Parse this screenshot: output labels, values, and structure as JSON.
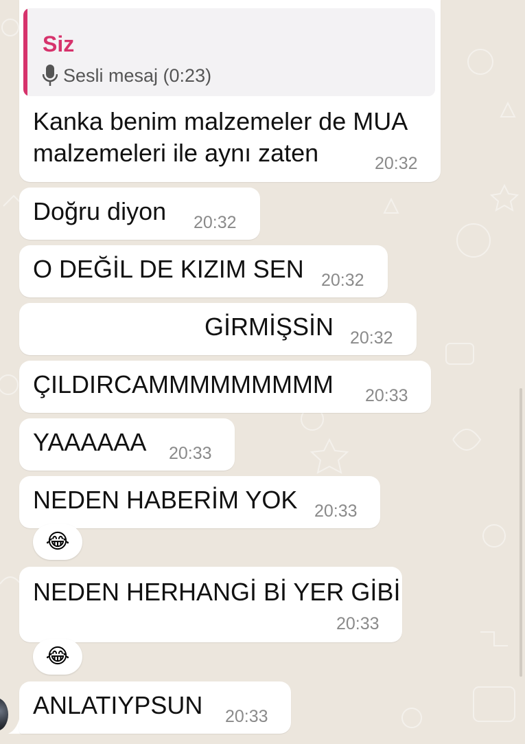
{
  "reply": {
    "author": "Siz",
    "voice_label": "Sesli mesaj (0:23)"
  },
  "messages": [
    {
      "lines": [
        "Kanka benim malzemeler de MUA",
        "malzemeleri ile aynı zaten"
      ],
      "time": "20:32"
    },
    {
      "text": "Doğru diyon",
      "time": "20:32"
    },
    {
      "text": "O DEĞİL DE KIZIM SEN",
      "time": "20:32"
    },
    {
      "text": "GİRMİŞSİN",
      "time": "20:32"
    },
    {
      "text": "ÇILDIRCAMMMMMMMMM",
      "time": "20:33"
    },
    {
      "text": "YAAAAAA",
      "time": "20:33"
    },
    {
      "text": "NEDEN HABERİM YOK",
      "time": "20:33"
    },
    {
      "text": "NEDEN HERHANGİ Bİ YER GİBİ",
      "time": "20:33"
    },
    {
      "text": "ANLATIYPSUN",
      "time": "20:33"
    }
  ],
  "reactions": [
    "😂",
    "😂"
  ],
  "colors": {
    "background": "#ece6dd",
    "bubble": "#ffffff",
    "reply_accent": "#d6336c",
    "timestamp": "#8a8a8a"
  }
}
